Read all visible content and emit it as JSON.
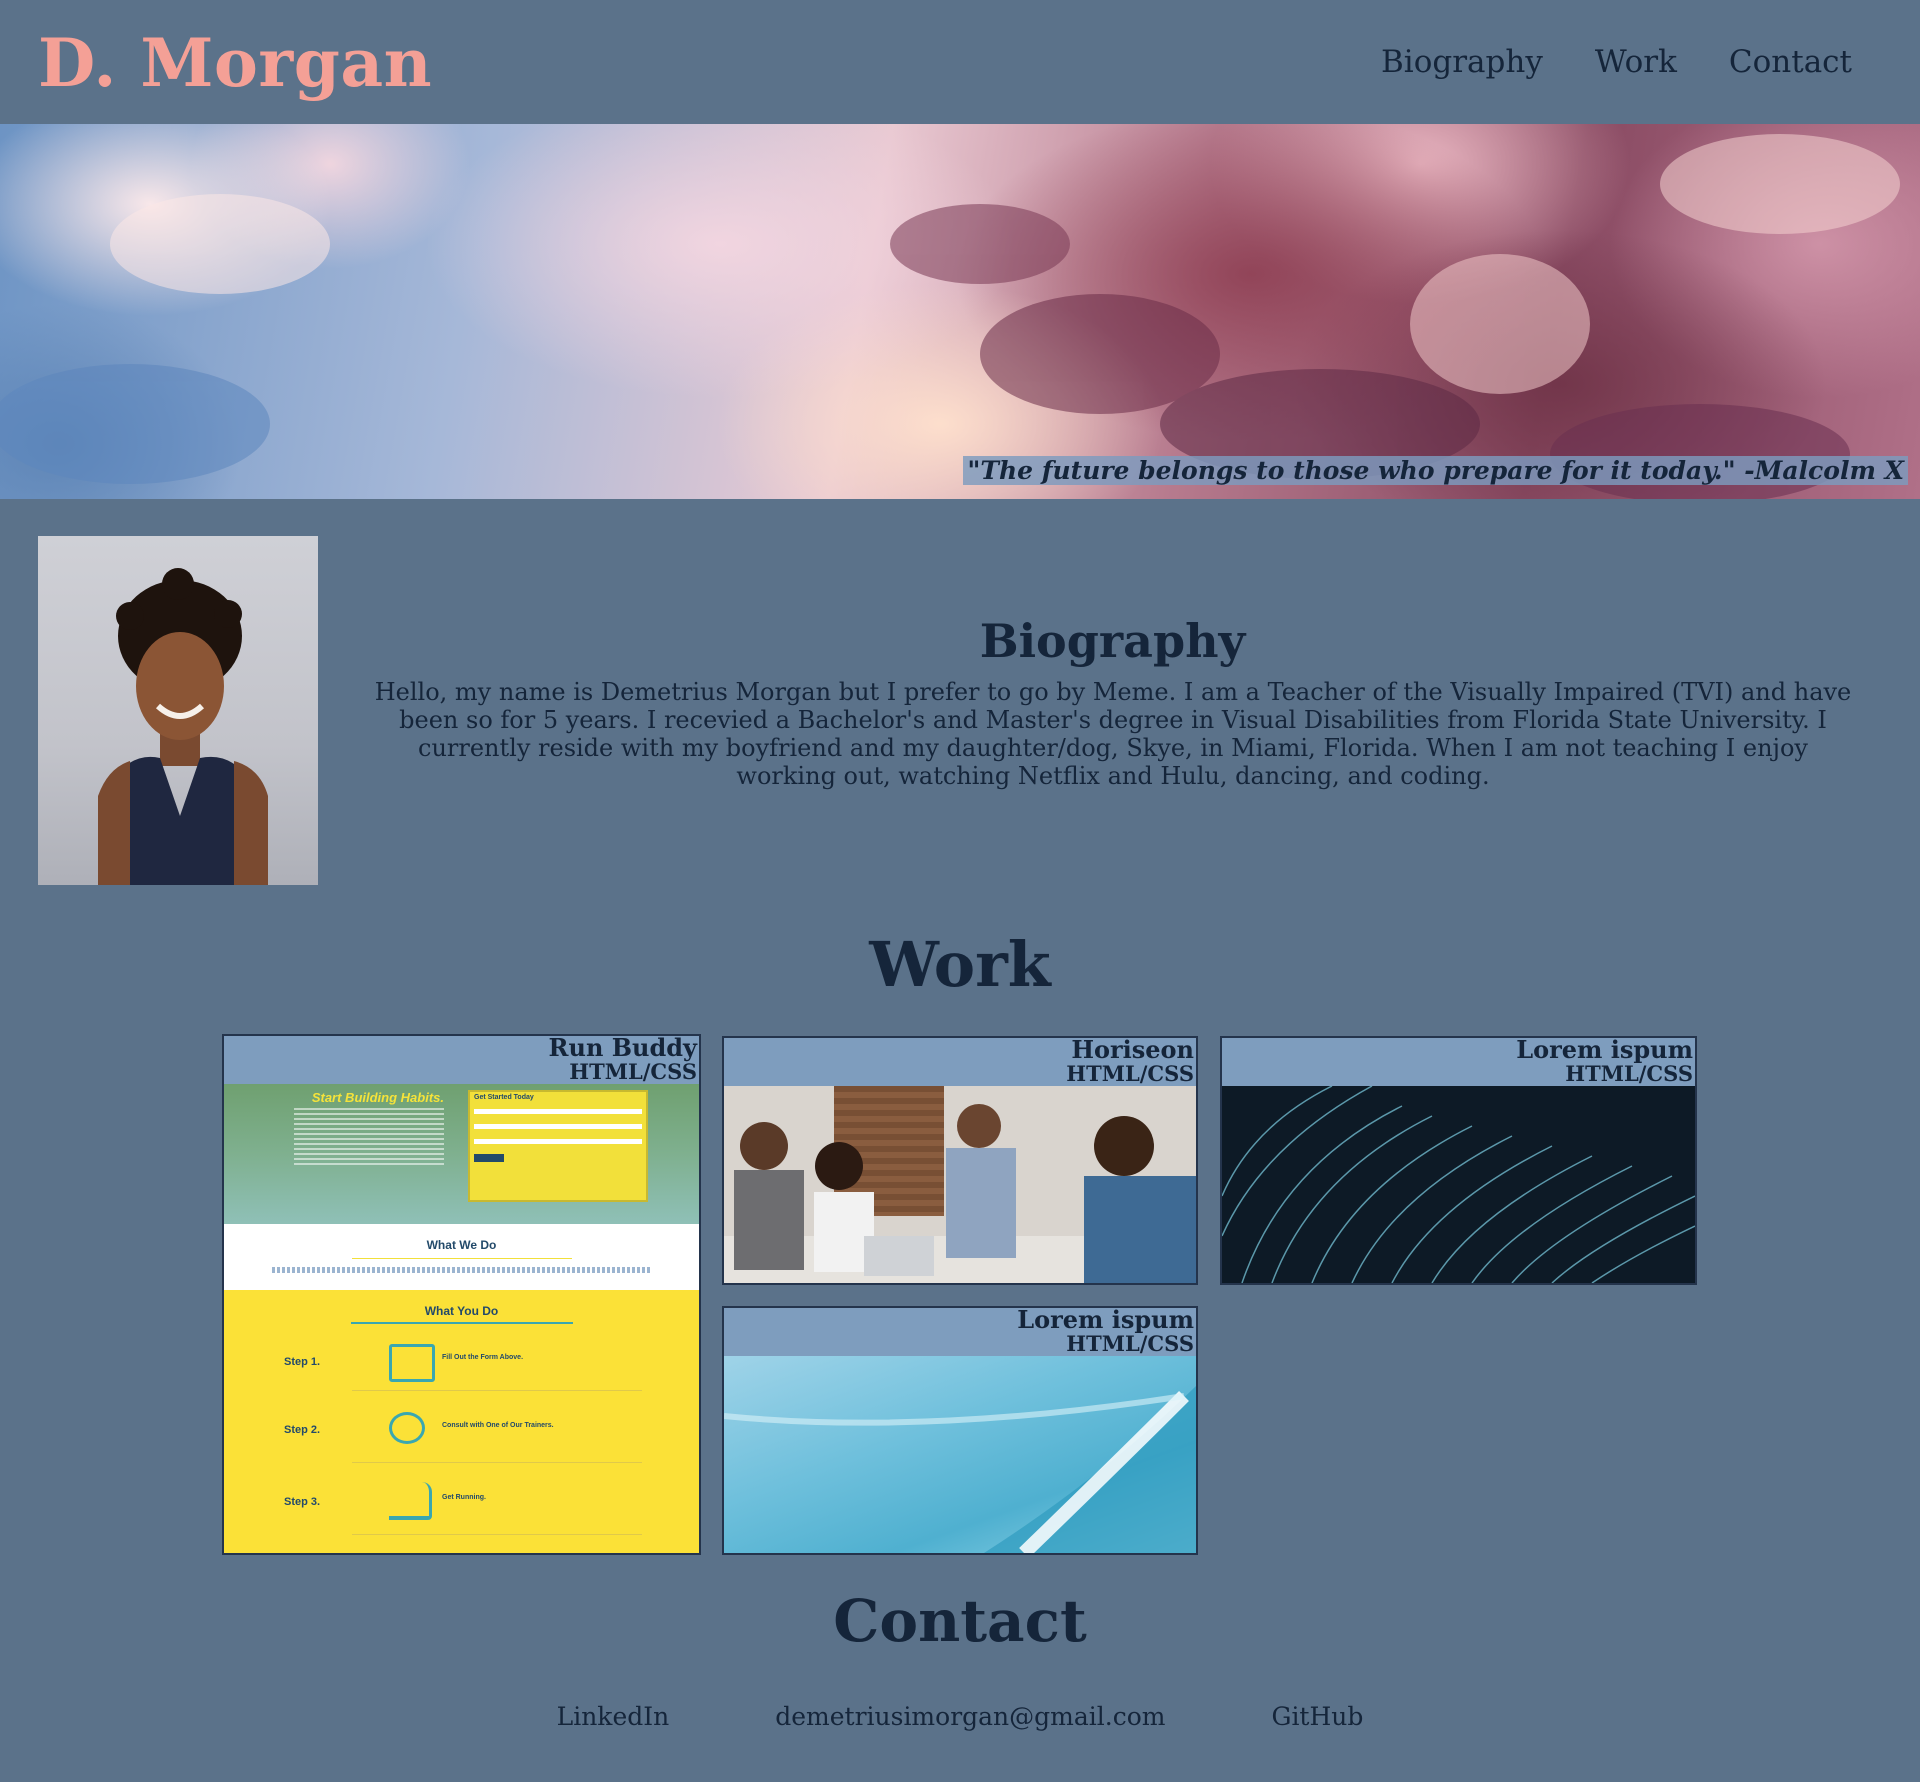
{
  "header": {
    "brand": "D. Morgan",
    "nav": [
      "Biography",
      "Work",
      "Contact"
    ]
  },
  "hero": {
    "quote": "\"The future belongs to those who prepare for it today.\" -Malcolm X"
  },
  "biography": {
    "title": "Biography",
    "text": "Hello, my name is Demetrius Morgan but I prefer to go by Meme. I am a Teacher of the Visually Impaired (TVI) and have been so for 5 years. I recevied a Bachelor's and Master's degree in Visual Disabilities from Florida State University. I currently reside with my boyfriend and my daughter/dog, Skye, in Miami, Florida. When I am not teaching I enjoy working out, watching Netflix and Hulu, dancing, and coding."
  },
  "work": {
    "title": "Work",
    "projects": [
      {
        "name": "Run Buddy",
        "tech": "HTML/CSS"
      },
      {
        "name": "Horiseon",
        "tech": "HTML/CSS"
      },
      {
        "name": "Lorem ispum",
        "tech": "HTML/CSS"
      },
      {
        "name": "Lorem ispum",
        "tech": "HTML/CSS"
      }
    ],
    "runbuddy_preview": {
      "hero_heading": "Start Building Habits.",
      "form_title": "Get Started Today",
      "section1": "What We Do",
      "section2": "What You Do",
      "steps": [
        {
          "label": "Step 1.",
          "text": "Fill Out the Form Above."
        },
        {
          "label": "Step 2.",
          "text": "Consult with One of Our Trainers."
        },
        {
          "label": "Step 3.",
          "text": "Get Running."
        }
      ]
    }
  },
  "contact": {
    "title": "Contact",
    "links": [
      "LinkedIn",
      "demetriusimorgan@gmail.com",
      "GitHub"
    ]
  }
}
